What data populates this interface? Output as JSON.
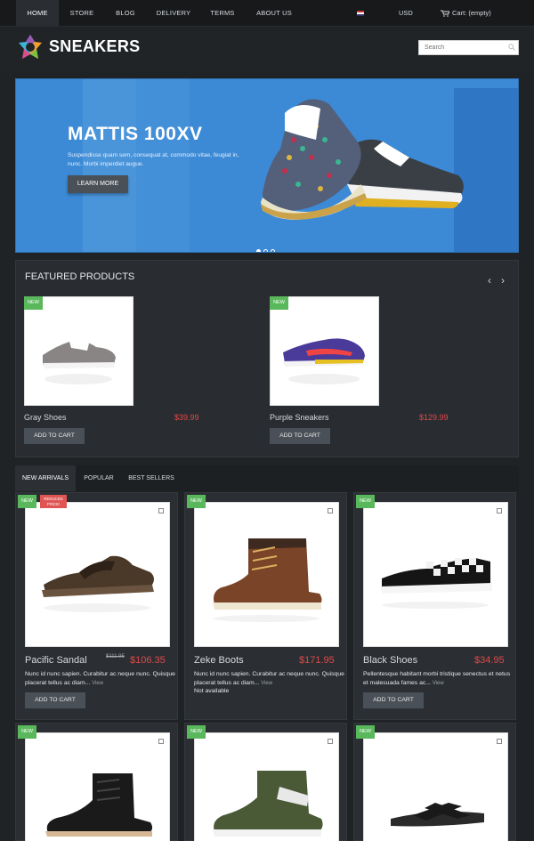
{
  "nav": {
    "items": [
      {
        "label": "HOME",
        "active": true
      },
      {
        "label": "STORE"
      },
      {
        "label": "BLOG"
      },
      {
        "label": "DELIVERY"
      },
      {
        "label": "TERMS"
      },
      {
        "label": "ABOUT US"
      }
    ],
    "currency": "USD",
    "cart": "Cart: (empty)"
  },
  "header": {
    "logo": "SNEAKERS",
    "search_placeholder": "Search"
  },
  "hero": {
    "title": "MATTIS 100XV",
    "text": "Suspendisse quam sem, consequat at, commodo vitae, feugiat in, nunc. Morbi imperdiet augue.",
    "button": "LEARN MORE",
    "slides": 3,
    "active_slide": 1
  },
  "featured": {
    "title": "FEATURED PRODUCTS",
    "products": [
      {
        "badge": "NEW",
        "name": "Gray Shoes",
        "price": "$39.99",
        "button": "ADD TO CART"
      },
      {
        "badge": "NEW",
        "name": "Purple Sneakers",
        "price": "$129.99",
        "button": "ADD TO CART"
      }
    ]
  },
  "tabs": [
    {
      "label": "NEW ARRIVALS",
      "active": true
    },
    {
      "label": "POPULAR"
    },
    {
      "label": "BEST SELLERS"
    }
  ],
  "grid": [
    {
      "badge": "NEW",
      "reduced": "REDUCED PRICE!",
      "name": "Pacific Sandal",
      "old_price": "$111.95",
      "price": "$106.35",
      "desc": "Nunc id nunc sapien. Curabitur ac neque nunc. Quisque placerat tellus ac diam...",
      "more": "View",
      "button": "ADD TO CART"
    },
    {
      "badge": "NEW",
      "name": "Zeke Boots",
      "price": "$171.95",
      "desc": "Nunc id nunc sapien. Curabitur ac neque nunc. Quisque placerat tellus ac diam...",
      "more": "View",
      "note": "Not available"
    },
    {
      "badge": "NEW",
      "name": "Black Shoes",
      "price": "$34.95",
      "desc": "Pellentesque habitant morbi tristique senectus et netus et malesuada fames ac...",
      "more": "View",
      "button": "ADD TO CART"
    },
    {
      "badge": "NEW"
    },
    {
      "badge": "NEW"
    },
    {
      "badge": "NEW"
    }
  ],
  "colors": {
    "accent_green": "#5ab85c",
    "price_red": "#e04848",
    "hero_blue": "#3c8ad6"
  }
}
